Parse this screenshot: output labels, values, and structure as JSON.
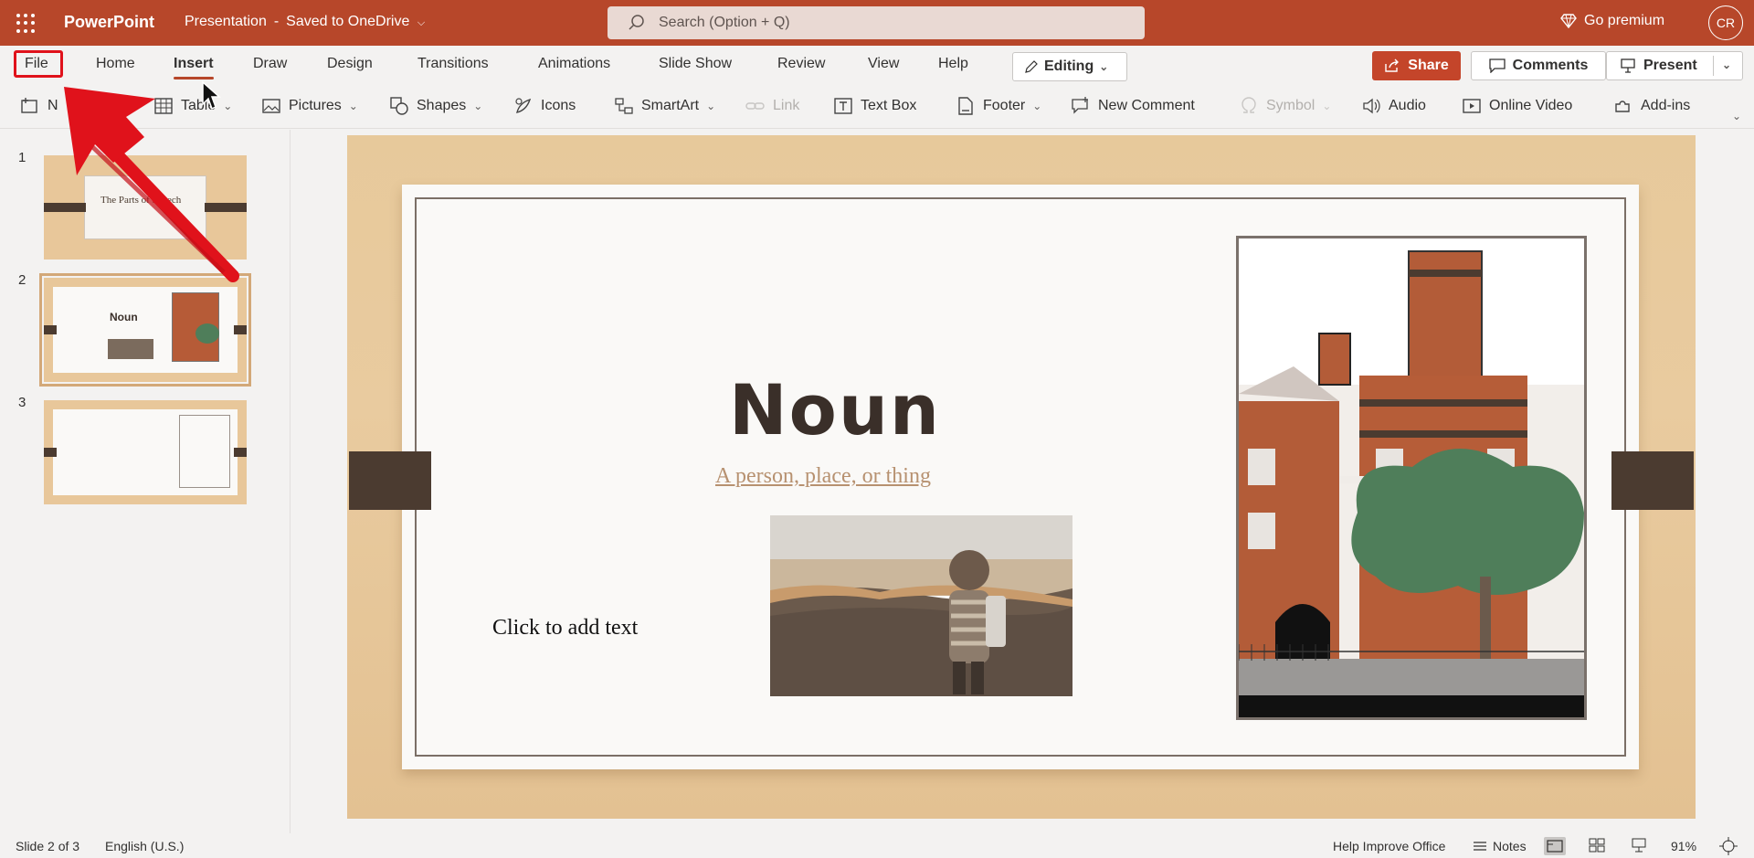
{
  "titlebar": {
    "app_name": "PowerPoint",
    "doc_title": "Presentation",
    "save_status": "Saved to OneDrive",
    "search_placeholder": "Search (Option + Q)",
    "go_premium": "Go premium",
    "avatar_initials": "CR",
    "bg_color": "#b7472a"
  },
  "tabs": {
    "items": [
      {
        "label": "File"
      },
      {
        "label": "Home"
      },
      {
        "label": "Insert"
      },
      {
        "label": "Draw"
      },
      {
        "label": "Design"
      },
      {
        "label": "Transitions"
      },
      {
        "label": "Animations"
      },
      {
        "label": "Slide Show"
      },
      {
        "label": "Review"
      },
      {
        "label": "View"
      },
      {
        "label": "Help"
      }
    ],
    "active": "Insert",
    "editing_label": "Editing",
    "share_label": "Share",
    "comments_label": "Comments",
    "present_label": "Present"
  },
  "commands": {
    "new_slide_partial": "N",
    "table": "Table",
    "pictures": "Pictures",
    "shapes": "Shapes",
    "icons": "Icons",
    "smartart": "SmartArt",
    "link": "Link",
    "text_box": "Text Box",
    "footer": "Footer",
    "new_comment": "New Comment",
    "symbol": "Symbol",
    "audio": "Audio",
    "online_video": "Online Video",
    "add_ins": "Add-ins"
  },
  "thumbnails": [
    {
      "number": "1",
      "title": "The Parts of Speech"
    },
    {
      "number": "2",
      "title": "Noun",
      "selected": true
    },
    {
      "number": "3",
      "title": ""
    }
  ],
  "slide": {
    "title": "Noun",
    "subtitle": "A person, place, or thing",
    "placeholder": "Click to add text"
  },
  "statusbar": {
    "slide_info": "Slide 2 of 3",
    "language": "English (U.S.)",
    "help_improve": "Help Improve Office",
    "notes": "Notes",
    "zoom": "91%"
  }
}
